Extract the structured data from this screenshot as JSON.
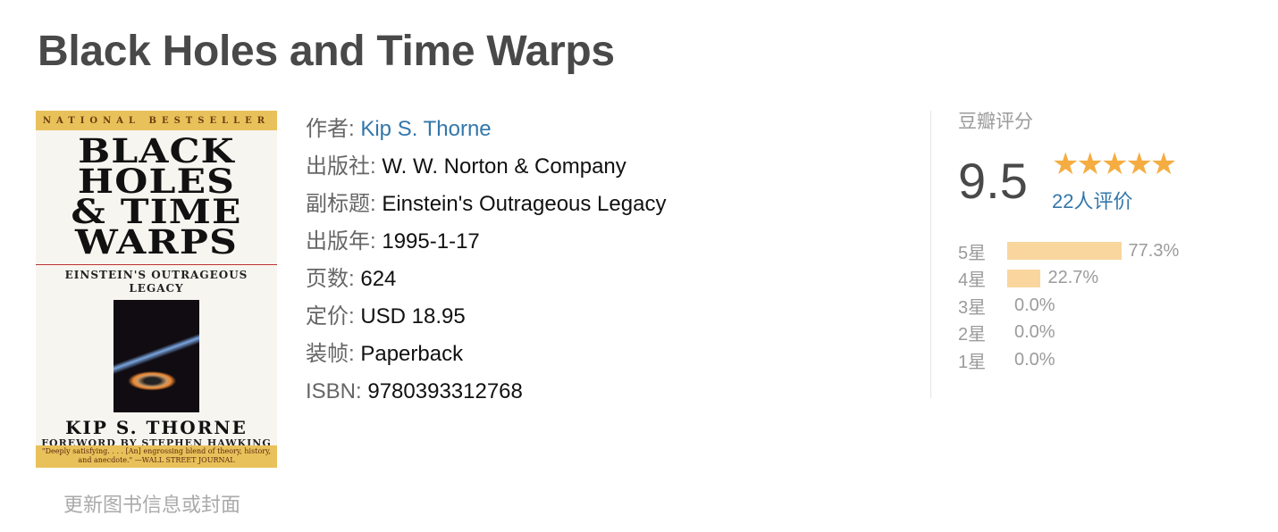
{
  "title": "Black Holes and Time Warps",
  "cover": {
    "band": "NATIONAL BESTSELLER",
    "title_lines": [
      "BLACK",
      "HOLES",
      "& TIME",
      "WARPS"
    ],
    "subtitle": "EINSTEIN'S OUTRAGEOUS LEGACY",
    "author": "KIP S. THORNE",
    "foreword": "FOREWORD BY STEPHEN HAWKING",
    "quote": "\"Deeply satisfying. . . . [An] engrossing blend of theory, history, and anecdote.\" —WALL STREET JOURNAL"
  },
  "update_link": "更新图书信息或封面",
  "info": [
    {
      "key": "作者:",
      "value": "Kip S. Thorne",
      "link": true
    },
    {
      "key": "出版社:",
      "value": "W. W. Norton & Company"
    },
    {
      "key": "副标题:",
      "value": "Einstein's Outrageous Legacy"
    },
    {
      "key": "出版年:",
      "value": "1995-1-17"
    },
    {
      "key": "页数:",
      "value": "624"
    },
    {
      "key": "定价:",
      "value": "USD 18.95"
    },
    {
      "key": "装帧:",
      "value": "Paperback"
    },
    {
      "key": "ISBN:",
      "value": "9780393312768"
    }
  ],
  "rating": {
    "label": "豆瓣评分",
    "score": "9.5",
    "stars": "★★★★★",
    "star_count": 5,
    "star_color": "#f5ad41",
    "votes": "22人评价",
    "distribution": [
      {
        "label": "5星",
        "percent": "77.3%",
        "value": 77.3
      },
      {
        "label": "4星",
        "percent": "22.7%",
        "value": 22.7
      },
      {
        "label": "3星",
        "percent": "0.0%",
        "value": 0
      },
      {
        "label": "2星",
        "percent": "0.0%",
        "value": 0
      },
      {
        "label": "1星",
        "percent": "0.0%",
        "value": 0
      }
    ]
  },
  "colors": {
    "link": "#3377aa",
    "bar": "#f9d69e"
  }
}
